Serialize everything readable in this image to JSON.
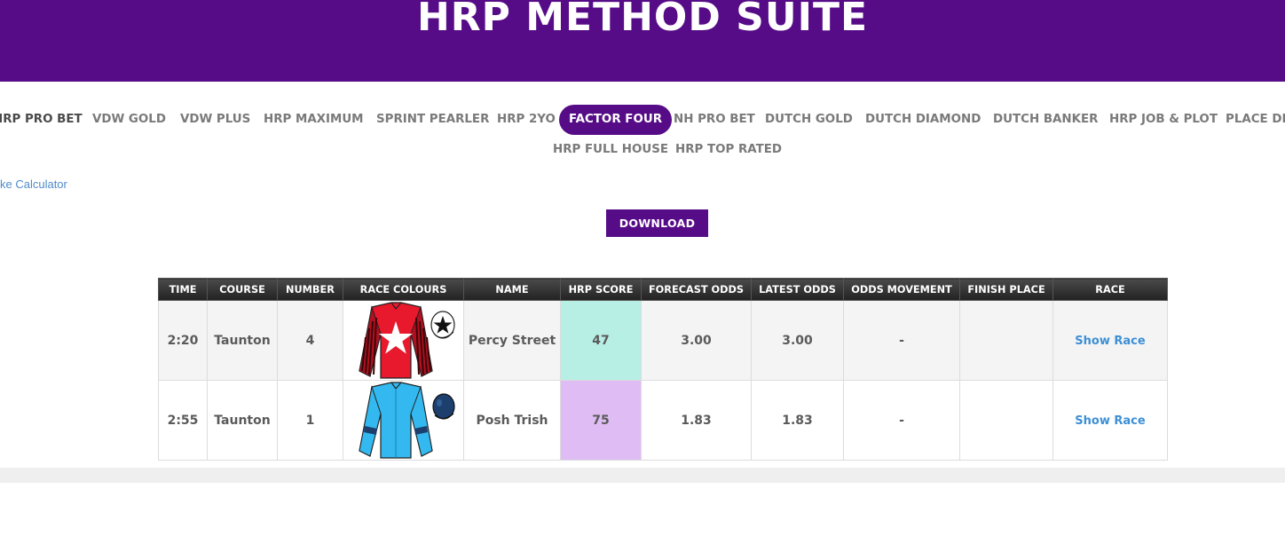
{
  "header": {
    "title": "HRP METHOD SUITE"
  },
  "nav": {
    "items": [
      {
        "label": "HRP PRO BET",
        "active": false
      },
      {
        "label": "VDW GOLD",
        "active": false
      },
      {
        "label": "VDW PLUS",
        "active": false
      },
      {
        "label": "HRP MAXIMUM",
        "active": false
      },
      {
        "label": "SPRINT PEARLER",
        "active": false
      },
      {
        "label": "HRP 2YO",
        "active": false
      },
      {
        "label": "FACTOR FOUR",
        "active": true
      },
      {
        "label": "NH PRO BET",
        "active": false
      },
      {
        "label": "DUTCH GOLD",
        "active": false
      },
      {
        "label": "DUTCH DIAMOND",
        "active": false
      },
      {
        "label": "DUTCH BANKER",
        "active": false
      },
      {
        "label": "HRP JOB & PLOT",
        "active": false
      },
      {
        "label": "PLACE DIA",
        "active": false
      },
      {
        "label": "HRP FULL HOUSE",
        "active": false
      },
      {
        "label": "HRP TOP RATED",
        "active": false
      }
    ]
  },
  "stake_link": "ke Calculator",
  "download_label": "DOWNLOAD",
  "table": {
    "columns": [
      "TIME",
      "COURSE",
      "NUMBER",
      "RACE COLOURS",
      "NAME",
      "HRP SCORE",
      "FORECAST ODDS",
      "LATEST ODDS",
      "ODDS MOVEMENT",
      "FINISH PLACE",
      "RACE"
    ],
    "rows": [
      {
        "time": "2:20",
        "course": "Taunton",
        "number": "4",
        "silk": "red-silk-white-star",
        "name": "Percy Street",
        "hrp_score": "47",
        "score_color": "#b8efe5",
        "forecast_odds": "3.00",
        "latest_odds": "3.00",
        "odds_movement": "-",
        "finish_place": "",
        "race_link": "Show Race"
      },
      {
        "time": "2:55",
        "course": "Taunton",
        "number": "1",
        "silk": "light-blue-silk-dark-blue-armbands",
        "name": "Posh Trish",
        "hrp_score": "75",
        "score_color": "#dfbdf4",
        "forecast_odds": "1.83",
        "latest_odds": "1.83",
        "odds_movement": "-",
        "finish_place": "",
        "race_link": "Show Race"
      }
    ]
  },
  "colors": {
    "brand": "#560c87",
    "link": "#3d8fd6"
  }
}
